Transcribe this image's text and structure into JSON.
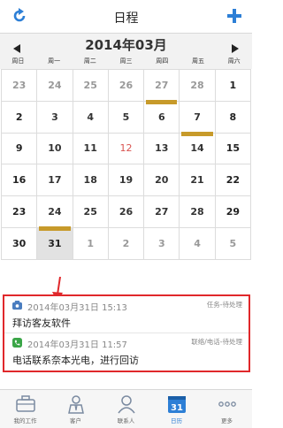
{
  "topbar": {
    "title": "日程",
    "refresh_icon": "refresh-icon",
    "add_icon": "plus-icon",
    "accent": "#2d7fd6"
  },
  "calendar": {
    "month_title": "2014年03月",
    "weekdays": [
      "周日",
      "周一",
      "周二",
      "周三",
      "周四",
      "周五",
      "周六"
    ],
    "weeks": [
      [
        {
          "d": "23",
          "muted": true
        },
        {
          "d": "24",
          "muted": true
        },
        {
          "d": "25",
          "muted": true
        },
        {
          "d": "26",
          "muted": true
        },
        {
          "d": "27",
          "muted": true,
          "mark": "bottom"
        },
        {
          "d": "28",
          "muted": true
        },
        {
          "d": "1",
          "weekend": true
        }
      ],
      [
        {
          "d": "2",
          "weekend": true
        },
        {
          "d": "3"
        },
        {
          "d": "4"
        },
        {
          "d": "5"
        },
        {
          "d": "6",
          "mark": "top"
        },
        {
          "d": "7",
          "mark": "bottom"
        },
        {
          "d": "8",
          "weekend": true
        }
      ],
      [
        {
          "d": "9",
          "weekend": true
        },
        {
          "d": "10"
        },
        {
          "d": "11"
        },
        {
          "d": "12",
          "today": true
        },
        {
          "d": "13"
        },
        {
          "d": "14",
          "mark": "top"
        },
        {
          "d": "15",
          "weekend": true
        }
      ],
      [
        {
          "d": "16",
          "weekend": true
        },
        {
          "d": "17"
        },
        {
          "d": "18"
        },
        {
          "d": "19"
        },
        {
          "d": "20"
        },
        {
          "d": "21"
        },
        {
          "d": "22",
          "weekend": true
        }
      ],
      [
        {
          "d": "23",
          "weekend": true
        },
        {
          "d": "24",
          "mark": "bottom"
        },
        {
          "d": "25"
        },
        {
          "d": "26"
        },
        {
          "d": "27"
        },
        {
          "d": "28"
        },
        {
          "d": "29",
          "weekend": true
        }
      ],
      [
        {
          "d": "30",
          "weekend": true
        },
        {
          "d": "31",
          "selected": true,
          "mark": "top"
        },
        {
          "d": "1",
          "muted": true
        },
        {
          "d": "2",
          "muted": true
        },
        {
          "d": "3",
          "muted": true
        },
        {
          "d": "4",
          "muted": true
        },
        {
          "d": "5",
          "muted": true
        }
      ]
    ],
    "mark_color": "#c79a2a",
    "today_color": "#d9534f"
  },
  "schedule": {
    "border_color": "#e0282b",
    "events": [
      {
        "icon": "phone-icon",
        "time": "2014年03月31日 15:13",
        "type": "任务-待处理",
        "desc": "拜访客友软件"
      },
      {
        "icon": "call-icon",
        "time": "2014年03月31日 11:57",
        "type": "联络/电话-待处理",
        "desc": "电话联系奈本光电，进行回访"
      }
    ]
  },
  "bottom_nav": {
    "items": [
      {
        "label": "我的工作",
        "icon": "briefcase-icon"
      },
      {
        "label": "客户",
        "icon": "customer-icon"
      },
      {
        "label": "联系人",
        "icon": "contact-icon"
      },
      {
        "label": "日历",
        "icon": "calendar-icon",
        "active": true
      },
      {
        "label": "更多",
        "icon": "more-icon"
      }
    ]
  }
}
